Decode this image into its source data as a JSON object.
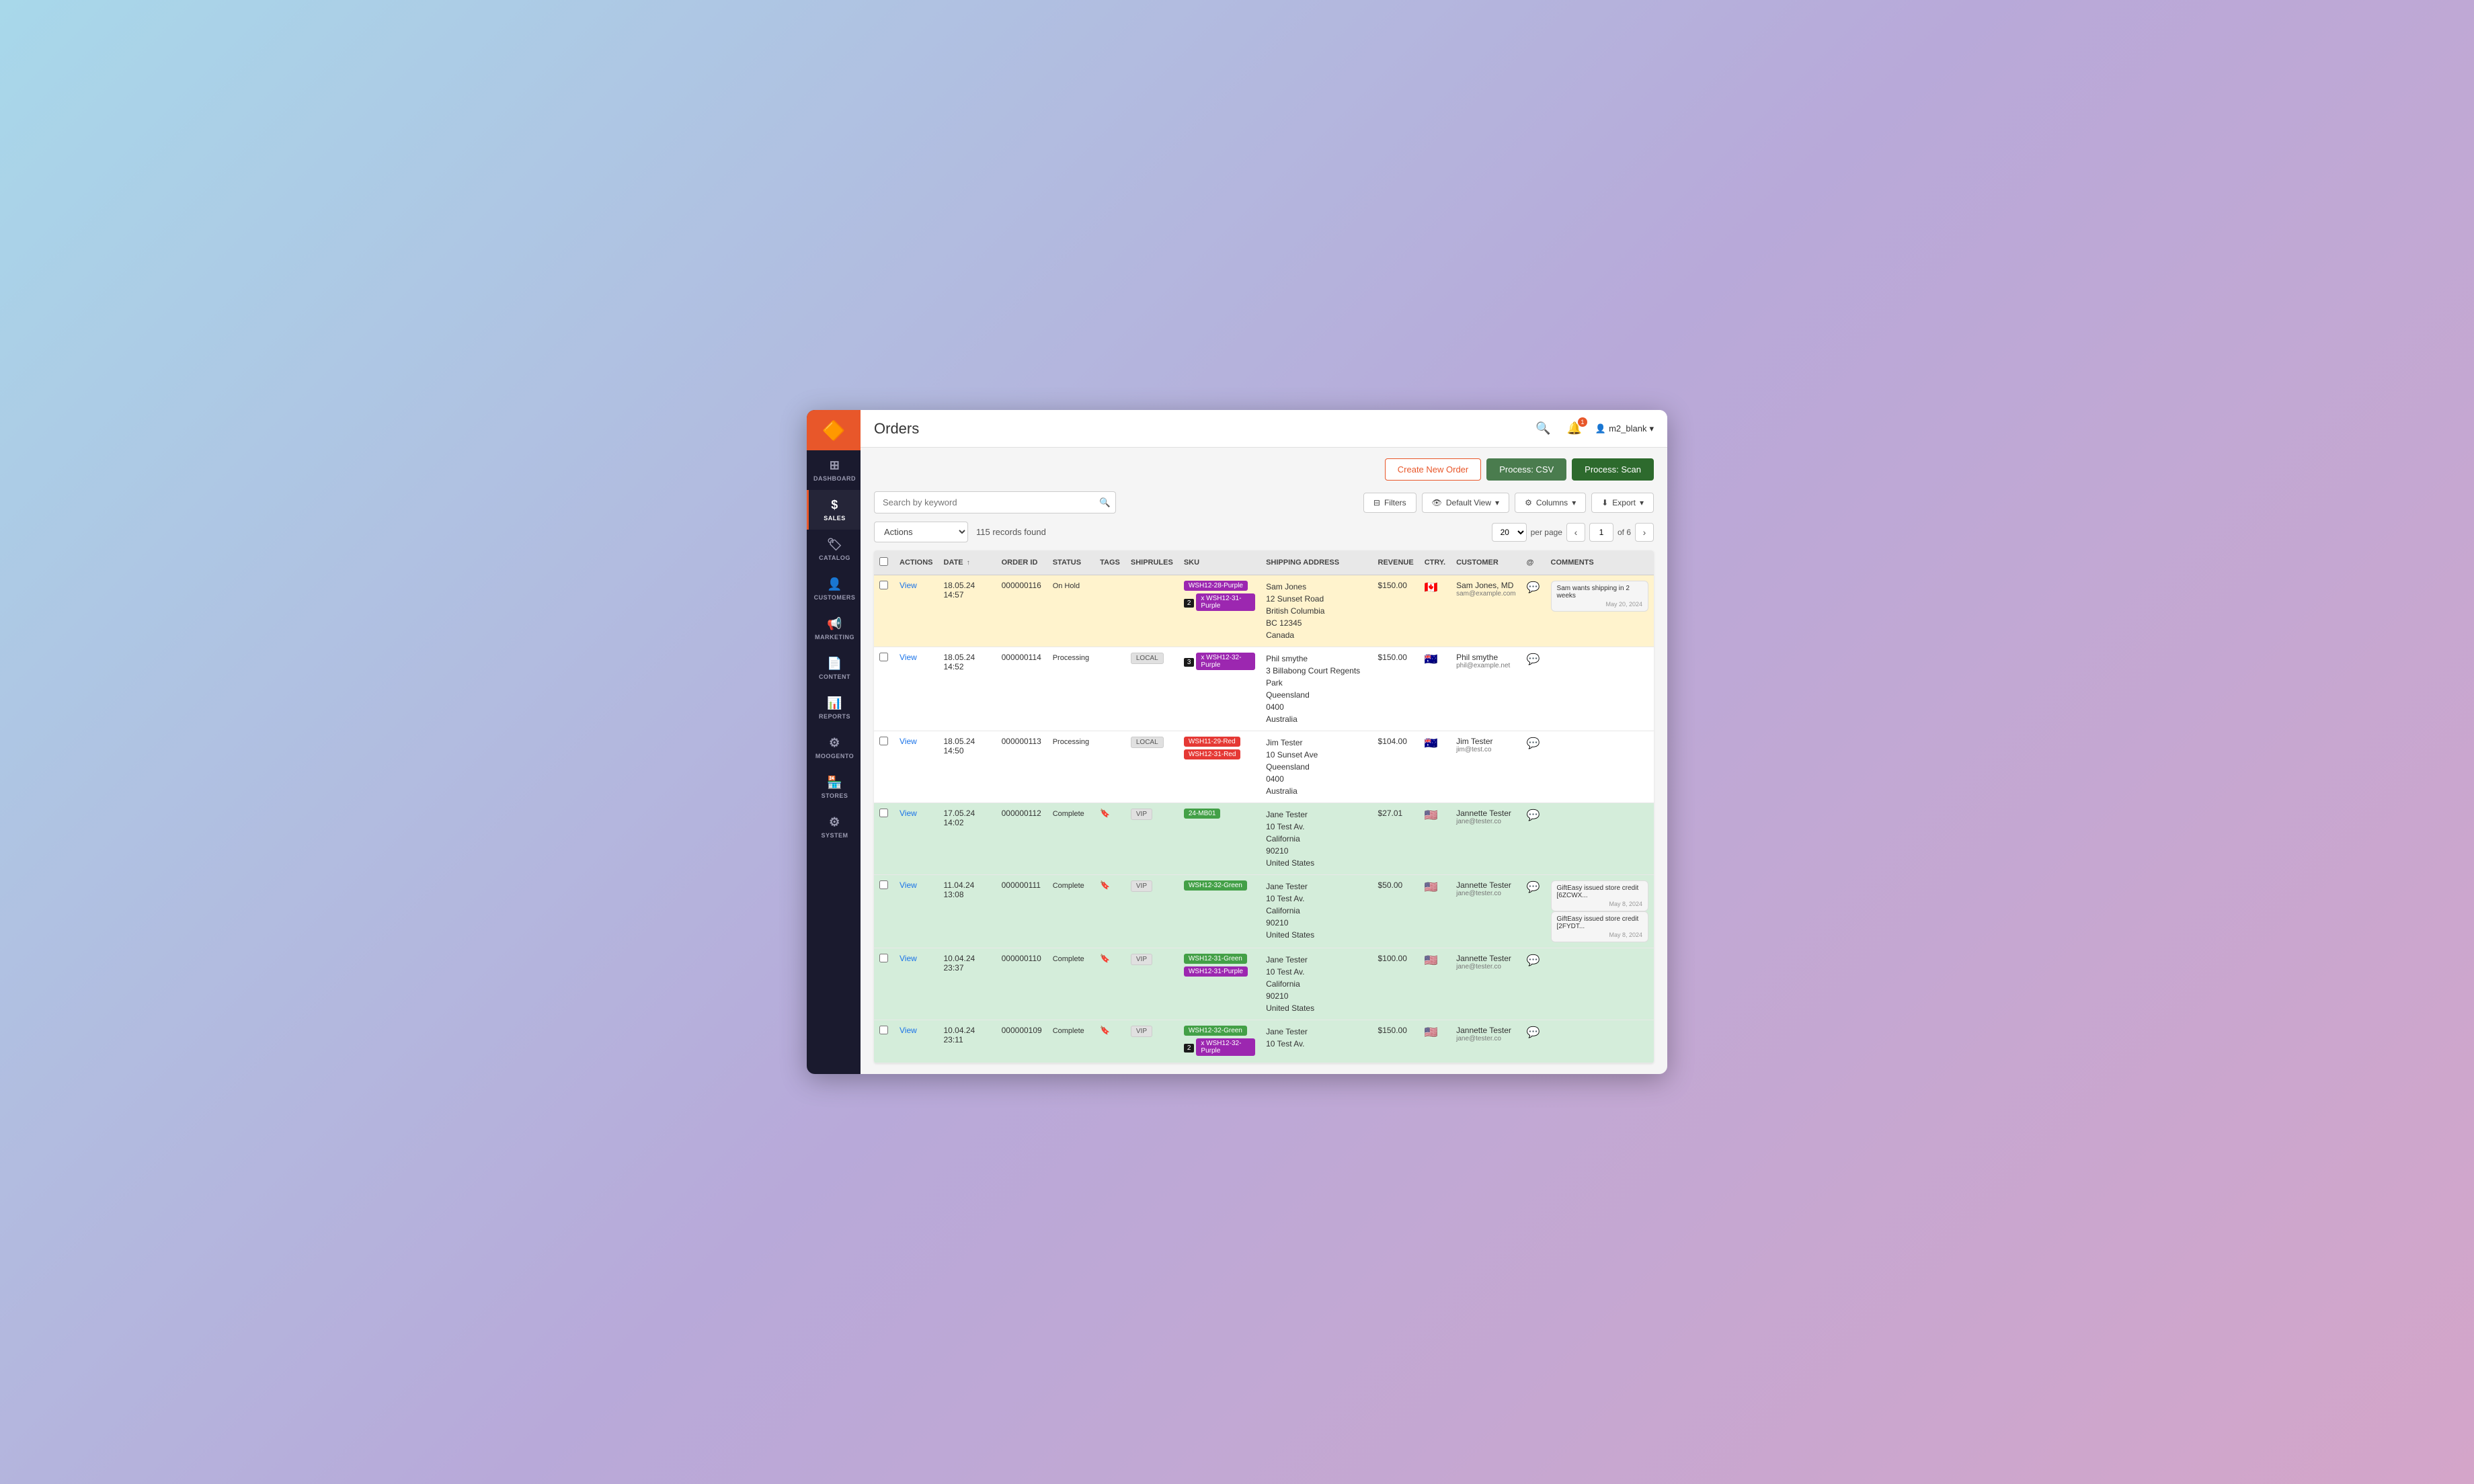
{
  "app": {
    "logo": "🔶",
    "title": "Orders"
  },
  "sidebar": {
    "items": [
      {
        "id": "dashboard",
        "label": "DASHBOARD",
        "icon": "⊞",
        "active": false
      },
      {
        "id": "sales",
        "label": "SALES",
        "icon": "$",
        "active": true
      },
      {
        "id": "catalog",
        "label": "CATALOG",
        "icon": "🏷",
        "active": false
      },
      {
        "id": "customers",
        "label": "CUSTOMERS",
        "icon": "👤",
        "active": false
      },
      {
        "id": "marketing",
        "label": "MARKETING",
        "icon": "📢",
        "active": false
      },
      {
        "id": "content",
        "label": "CONTENT",
        "icon": "📄",
        "active": false
      },
      {
        "id": "reports",
        "label": "REPORTS",
        "icon": "📊",
        "active": false
      },
      {
        "id": "moogento",
        "label": "MOOGENTO",
        "icon": "⚙",
        "active": false
      },
      {
        "id": "stores",
        "label": "STORES",
        "icon": "🏪",
        "active": false
      },
      {
        "id": "system",
        "label": "SYSTEM",
        "icon": "⚙",
        "active": false
      }
    ]
  },
  "topbar": {
    "title": "Orders",
    "search_icon": "🔍",
    "notification_count": "1",
    "user_name": "m2_blank",
    "chevron": "▾"
  },
  "toolbar": {
    "create_order_label": "Create New Order",
    "process_csv_label": "Process: CSV",
    "process_scan_label": "Process: Scan"
  },
  "search": {
    "placeholder": "Search by keyword"
  },
  "filters": {
    "filters_label": "Filters",
    "default_view_label": "Default View",
    "columns_label": "Columns",
    "export_label": "Export"
  },
  "actions": {
    "label": "Actions",
    "records_count": "115 records found"
  },
  "pagination": {
    "per_page": "20",
    "current_page": "1",
    "total_pages": "of 6",
    "per_page_label": "per page"
  },
  "table": {
    "headers": [
      {
        "id": "checkbox",
        "label": ""
      },
      {
        "id": "actions",
        "label": "ACTIONS"
      },
      {
        "id": "date",
        "label": "DATE"
      },
      {
        "id": "order_id",
        "label": "ORDER ID"
      },
      {
        "id": "status",
        "label": "STATUS"
      },
      {
        "id": "tags",
        "label": "TAGS"
      },
      {
        "id": "shiprules",
        "label": "SHIPRULES"
      },
      {
        "id": "sku",
        "label": "SKU"
      },
      {
        "id": "shipping_address",
        "label": "SHIPPING ADDRESS"
      },
      {
        "id": "revenue",
        "label": "REVENUE"
      },
      {
        "id": "ctry",
        "label": "CTRY."
      },
      {
        "id": "customer",
        "label": "CUSTOMER"
      },
      {
        "id": "at",
        "label": "@"
      },
      {
        "id": "comments",
        "label": "COMMENTS"
      }
    ],
    "rows": [
      {
        "id": "row1",
        "row_class": "on-hold",
        "actions": "View",
        "date": "18.05.24 14:57",
        "order_id": "000000116",
        "status": "On Hold",
        "tags": "",
        "shiprules": "",
        "skus": [
          {
            "label": "WSH12-28-Purple",
            "color": "purple",
            "prefix": ""
          },
          {
            "label": "x WSH12-31-Purple",
            "color": "purple",
            "prefix": "2"
          }
        ],
        "shipping_address": "Sam Jones\n12 Sunset Road\nBritish Columbia\nBC 12345\nCanada",
        "revenue": "$150.00",
        "flag": "🇨🇦",
        "customer_name": "Sam Jones, MD",
        "customer_email": "sam@example.com",
        "has_comment_icon": true,
        "comments": [
          {
            "text": "Sam wants shipping in 2 weeks",
            "date": "May 20, 2024"
          }
        ]
      },
      {
        "id": "row2",
        "row_class": "processing",
        "actions": "View",
        "date": "18.05.24 14:52",
        "order_id": "000000114",
        "status": "Processing",
        "tags": "",
        "shiprules": "LOCAL",
        "skus": [
          {
            "label": "x WSH12-32-Purple",
            "color": "purple",
            "prefix": "3"
          }
        ],
        "shipping_address": "Phil smythe\n3 Billabong Court Regents Park\nQueensland\n0400\nAustralia",
        "revenue": "$150.00",
        "flag": "🇦🇺",
        "customer_name": "Phil smythe",
        "customer_email": "phil@example.net",
        "has_comment_icon": true,
        "comments": []
      },
      {
        "id": "row3",
        "row_class": "processing",
        "actions": "View",
        "date": "18.05.24 14:50",
        "order_id": "000000113",
        "status": "Processing",
        "tags": "",
        "shiprules": "LOCAL",
        "skus": [
          {
            "label": "WSH11-29-Red",
            "color": "red",
            "prefix": ""
          },
          {
            "label": "WSH12-31-Red",
            "color": "red",
            "prefix": ""
          }
        ],
        "shipping_address": "Jim Tester\n10 Sunset Ave\nQueensland\n0400\nAustralia",
        "revenue": "$104.00",
        "flag": "🇦🇺",
        "customer_name": "Jim Tester",
        "customer_email": "jim@test.co",
        "has_comment_icon": true,
        "comments": []
      },
      {
        "id": "row4",
        "row_class": "complete",
        "actions": "View",
        "date": "17.05.24 14:02",
        "order_id": "000000112",
        "status": "Complete",
        "tags": "🔖",
        "shiprules": "VIP",
        "skus": [
          {
            "label": "24-MB01",
            "color": "green",
            "prefix": ""
          }
        ],
        "shipping_address": "Jane Tester\n10 Test Av.\nCalifornia\n90210\nUnited States",
        "revenue": "$27.01",
        "flag": "🇺🇸",
        "customer_name": "Jannette Tester",
        "customer_email": "jane@tester.co",
        "has_comment_icon": true,
        "comments": []
      },
      {
        "id": "row5",
        "row_class": "complete",
        "actions": "View",
        "date": "11.04.24 13:08",
        "order_id": "000000111",
        "status": "Complete",
        "tags": "🔖",
        "shiprules": "VIP",
        "skus": [
          {
            "label": "WSH12-32-Green",
            "color": "green",
            "prefix": ""
          }
        ],
        "shipping_address": "Jane Tester\n10 Test Av.\nCalifornia\n90210\nUnited States",
        "revenue": "$50.00",
        "flag": "🇺🇸",
        "customer_name": "Jannette Tester",
        "customer_email": "jane@tester.co",
        "has_comment_icon": true,
        "comments": [
          {
            "text": "GiftEasy issued store credit [6ZCWX...",
            "date": "May 8, 2024"
          },
          {
            "text": "GiftEasy issued store credit [2FYDT...",
            "date": "May 8, 2024"
          }
        ]
      },
      {
        "id": "row6",
        "row_class": "complete",
        "actions": "View",
        "date": "10.04.24 23:37",
        "order_id": "000000110",
        "status": "Complete",
        "tags": "🔖",
        "shiprules": "VIP",
        "skus": [
          {
            "label": "WSH12-31-Green",
            "color": "green",
            "prefix": ""
          },
          {
            "label": "WSH12-31-Purple",
            "color": "purple",
            "prefix": ""
          }
        ],
        "shipping_address": "Jane Tester\n10 Test Av.\nCalifornia\n90210\nUnited States",
        "revenue": "$100.00",
        "flag": "🇺🇸",
        "customer_name": "Jannette Tester",
        "customer_email": "jane@tester.co",
        "has_comment_icon": true,
        "comments": []
      },
      {
        "id": "row7",
        "row_class": "complete",
        "actions": "View",
        "date": "10.04.24 23:11",
        "order_id": "000000109",
        "status": "Complete",
        "tags": "🔖",
        "shiprules": "VIP",
        "skus": [
          {
            "label": "WSH12-32-Green",
            "color": "green",
            "prefix": ""
          },
          {
            "label": "x WSH12-32-Purple",
            "color": "purple",
            "prefix": "2"
          }
        ],
        "shipping_address": "Jane Tester\n10 Test Av.",
        "revenue": "$150.00",
        "flag": "🇺🇸",
        "customer_name": "Jannette Tester",
        "customer_email": "jane@tester.co",
        "has_comment_icon": true,
        "comments": []
      }
    ]
  }
}
